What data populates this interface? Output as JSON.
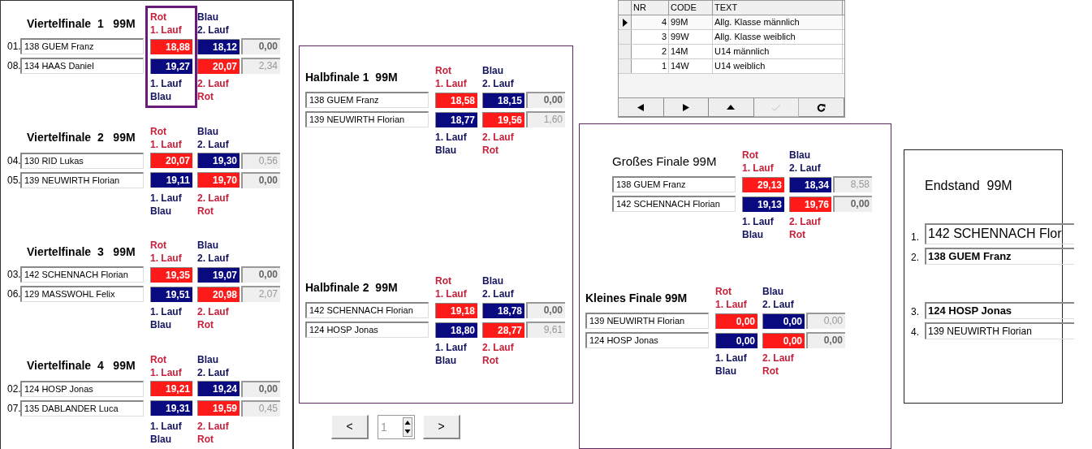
{
  "left_panel": {
    "matches": [
      {
        "title": "Viertelfinale  1   99M",
        "selected": true,
        "header": [
          {
            "lines": [
              "Rot",
              "1. Lauf"
            ],
            "color": "#c8203a"
          },
          {
            "lines": [
              "Blau",
              "2. Lauf"
            ],
            "color": "#14145e"
          }
        ],
        "rows": [
          {
            "seed": "01.",
            "name": "138 GUEM Franz",
            "runs": [
              {
                "value": "18,88",
                "color": "#ff1a1a"
              },
              {
                "value": "18,12",
                "color": "#0a0a80"
              }
            ],
            "diff": "0,00",
            "winner": true
          },
          {
            "seed": "08.",
            "name": "134 HAAS Daniel",
            "runs": [
              {
                "value": "19,27",
                "color": "#0a0a80"
              },
              {
                "value": "20,07",
                "color": "#ff1a1a"
              }
            ],
            "diff": "2,34",
            "winner": false
          }
        ],
        "footer": [
          {
            "lines": [
              "1. Lauf",
              "Blau"
            ],
            "color": "#14145e"
          },
          {
            "lines": [
              "2. Lauf",
              "Rot"
            ],
            "color": "#c8203a"
          }
        ]
      },
      {
        "title": "Viertelfinale  2   99M",
        "selected": false,
        "header": [
          {
            "lines": [
              "Rot",
              "1. Lauf"
            ],
            "color": "#c8203a"
          },
          {
            "lines": [
              "Blau",
              "2. Lauf"
            ],
            "color": "#14145e"
          }
        ],
        "rows": [
          {
            "seed": "04.",
            "name": "130 RID Lukas",
            "runs": [
              {
                "value": "20,07",
                "color": "#ff1a1a"
              },
              {
                "value": "19,30",
                "color": "#0a0a80"
              }
            ],
            "diff": "0,56",
            "winner": false
          },
          {
            "seed": "05.",
            "name": "139 NEUWIRTH Florian",
            "runs": [
              {
                "value": "19,11",
                "color": "#0a0a80"
              },
              {
                "value": "19,70",
                "color": "#ff1a1a"
              }
            ],
            "diff": "0,00",
            "winner": true
          }
        ],
        "footer": [
          {
            "lines": [
              "1. Lauf",
              "Blau"
            ],
            "color": "#14145e"
          },
          {
            "lines": [
              "2. Lauf",
              "Rot"
            ],
            "color": "#c8203a"
          }
        ]
      },
      {
        "title": "Viertelfinale  3   99M",
        "selected": false,
        "header": [
          {
            "lines": [
              "Rot",
              "1. Lauf"
            ],
            "color": "#c8203a"
          },
          {
            "lines": [
              "Blau",
              "2. Lauf"
            ],
            "color": "#14145e"
          }
        ],
        "rows": [
          {
            "seed": "03.",
            "name": "142 SCHENNACH Florian",
            "runs": [
              {
                "value": "19,35",
                "color": "#ff1a1a"
              },
              {
                "value": "19,07",
                "color": "#0a0a80"
              }
            ],
            "diff": "0,00",
            "winner": true
          },
          {
            "seed": "06.",
            "name": "129 MASSWOHL Felix",
            "runs": [
              {
                "value": "19,51",
                "color": "#0a0a80"
              },
              {
                "value": "20,98",
                "color": "#ff1a1a"
              }
            ],
            "diff": "2,07",
            "winner": false
          }
        ],
        "footer": [
          {
            "lines": [
              "1. Lauf",
              "Blau"
            ],
            "color": "#14145e"
          },
          {
            "lines": [
              "2. Lauf",
              "Rot"
            ],
            "color": "#c8203a"
          }
        ]
      },
      {
        "title": "Viertelfinale  4   99M",
        "selected": false,
        "header": [
          {
            "lines": [
              "Rot",
              "1. Lauf"
            ],
            "color": "#c8203a"
          },
          {
            "lines": [
              "Blau",
              "2. Lauf"
            ],
            "color": "#14145e"
          }
        ],
        "rows": [
          {
            "seed": "02.",
            "name": "124 HOSP Jonas",
            "runs": [
              {
                "value": "19,21",
                "color": "#ff1a1a"
              },
              {
                "value": "19,24",
                "color": "#0a0a80"
              }
            ],
            "diff": "0,00",
            "winner": true
          },
          {
            "seed": "07.",
            "name": "135 DABLANDER Luca",
            "runs": [
              {
                "value": "19,31",
                "color": "#0a0a80"
              },
              {
                "value": "19,59",
                "color": "#ff1a1a"
              }
            ],
            "diff": "0,45",
            "winner": false
          }
        ],
        "footer": [
          {
            "lines": [
              "1. Lauf",
              "Blau"
            ],
            "color": "#14145e"
          },
          {
            "lines": [
              "2. Lauf",
              "Rot"
            ],
            "color": "#c8203a"
          }
        ]
      }
    ]
  },
  "middle_panel": {
    "matches": [
      {
        "title": "Halbfinale 1  99M",
        "header": [
          {
            "lines": [
              "Rot",
              "1. Lauf"
            ],
            "color": "#c8203a"
          },
          {
            "lines": [
              "Blau",
              "2. Lauf"
            ],
            "color": "#14145e"
          }
        ],
        "rows": [
          {
            "name": "138 GUEM Franz",
            "runs": [
              {
                "value": "18,58",
                "color": "#ff1a1a"
              },
              {
                "value": "18,15",
                "color": "#0a0a80"
              }
            ],
            "diff": "0,00",
            "winner": true
          },
          {
            "name": "139 NEUWIRTH Florian",
            "runs": [
              {
                "value": "18,77",
                "color": "#0a0a80"
              },
              {
                "value": "19,56",
                "color": "#ff1a1a"
              }
            ],
            "diff": "1,60",
            "winner": false
          }
        ],
        "footer": [
          {
            "lines": [
              "1. Lauf",
              "Blau"
            ],
            "color": "#14145e"
          },
          {
            "lines": [
              "2. Lauf",
              "Rot"
            ],
            "color": "#c8203a"
          }
        ]
      },
      {
        "title": "Halbfinale 2  99M",
        "header": [
          {
            "lines": [
              "Rot",
              "1. Lauf"
            ],
            "color": "#c8203a"
          },
          {
            "lines": [
              "Blau",
              "2. Lauf"
            ],
            "color": "#14145e"
          }
        ],
        "rows": [
          {
            "name": "142 SCHENNACH Florian",
            "runs": [
              {
                "value": "19,18",
                "color": "#ff1a1a"
              },
              {
                "value": "18,78",
                "color": "#0a0a80"
              }
            ],
            "diff": "0,00",
            "winner": true
          },
          {
            "name": "124 HOSP Jonas",
            "runs": [
              {
                "value": "18,80",
                "color": "#0a0a80"
              },
              {
                "value": "28,77",
                "color": "#ff1a1a"
              }
            ],
            "diff": "9,61",
            "winner": false
          }
        ],
        "footer": [
          {
            "lines": [
              "1. Lauf",
              "Blau"
            ],
            "color": "#14145e"
          },
          {
            "lines": [
              "2. Lauf",
              "Rot"
            ],
            "color": "#c8203a"
          }
        ]
      }
    ]
  },
  "pager": {
    "prev": "<",
    "value": "1",
    "next": ">"
  },
  "class_table": {
    "columns": [
      "NR",
      "CODE",
      "TEXT"
    ],
    "rows": [
      {
        "nr": "4",
        "code": "99M",
        "text": "Allg. Klasse männlich",
        "selected": true
      },
      {
        "nr": "3",
        "code": "99W",
        "text": "Allg. Klasse weiblich",
        "selected": false
      },
      {
        "nr": "2",
        "code": "14M",
        "text": "U14 männlich",
        "selected": false
      },
      {
        "nr": "1",
        "code": "14W",
        "text": "U14 weiblich",
        "selected": false
      }
    ],
    "nav_buttons": [
      {
        "kind": "prior",
        "disabled": false
      },
      {
        "kind": "next",
        "disabled": false
      },
      {
        "kind": "up",
        "disabled": false
      },
      {
        "kind": "post",
        "disabled": true
      },
      {
        "kind": "refresh",
        "disabled": false
      }
    ]
  },
  "finals_panel": {
    "matches": [
      {
        "title": "Großes Finale 99M",
        "header": [
          {
            "lines": [
              "Rot",
              "1. Lauf"
            ],
            "color": "#c8203a"
          },
          {
            "lines": [
              "Blau",
              "2. Lauf"
            ],
            "color": "#14145e"
          }
        ],
        "rows": [
          {
            "name": "138 GUEM Franz",
            "runs": [
              {
                "value": "29,13",
                "color": "#ff1a1a"
              },
              {
                "value": "18,34",
                "color": "#0a0a80"
              }
            ],
            "diff": "8,58",
            "winner": false
          },
          {
            "name": "142 SCHENNACH Florian",
            "runs": [
              {
                "value": "19,13",
                "color": "#0a0a80"
              },
              {
                "value": "19,76",
                "color": "#ff1a1a"
              }
            ],
            "diff": "0,00",
            "winner": true
          }
        ],
        "footer": [
          {
            "lines": [
              "1. Lauf",
              "Blau"
            ],
            "color": "#14145e"
          },
          {
            "lines": [
              "2. Lauf",
              "Rot"
            ],
            "color": "#c8203a"
          }
        ]
      },
      {
        "title": "Kleines Finale 99M",
        "header": [
          {
            "lines": [
              "Rot",
              "1. Lauf"
            ],
            "color": "#c8203a"
          },
          {
            "lines": [
              "Blau",
              "2. Lauf"
            ],
            "color": "#14145e"
          }
        ],
        "rows": [
          {
            "name": "139 NEUWIRTH Florian",
            "runs": [
              {
                "value": "0,00",
                "color": "#ff1a1a"
              },
              {
                "value": "0,00",
                "color": "#0a0a80"
              }
            ],
            "diff": "0,00",
            "winner": false
          },
          {
            "name": "124 HOSP Jonas",
            "runs": [
              {
                "value": "0,00",
                "color": "#0a0a80"
              },
              {
                "value": "0,00",
                "color": "#ff1a1a"
              }
            ],
            "diff": "0,00",
            "winner": true
          }
        ],
        "footer": [
          {
            "lines": [
              "1. Lauf",
              "Blau"
            ],
            "color": "#14145e"
          },
          {
            "lines": [
              "2. Lauf",
              "Rot"
            ],
            "color": "#c8203a"
          }
        ]
      }
    ]
  },
  "final_standings": {
    "title": "Endstand  99M",
    "places": [
      {
        "rank": "1.",
        "name": "142 SCHENNACH Flor"
      },
      {
        "rank": "2.",
        "name": "138 GUEM Franz"
      },
      {
        "rank": "3.",
        "name": "124 HOSP Jonas"
      },
      {
        "rank": "4.",
        "name": "139 NEUWIRTH Florian"
      }
    ]
  }
}
